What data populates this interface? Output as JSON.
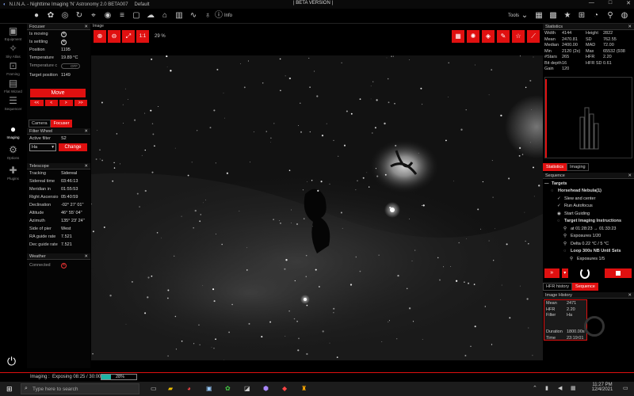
{
  "window": {
    "title": "N.I.N.A. - Nighttime Imaging 'N' Astronomy 2.0 BETA007",
    "profile": "Default",
    "beta_label": "| BETA VERSION |",
    "buttons": [
      "—",
      "□",
      "✕"
    ]
  },
  "toolbar": {
    "info_label": "Info",
    "tools_label": "Tools"
  },
  "sidebar": {
    "items": [
      {
        "label": "Equipment"
      },
      {
        "label": "Sky Atlas"
      },
      {
        "label": "Framing"
      },
      {
        "label": "Flat Wizard"
      },
      {
        "label": "Sequencer"
      },
      {
        "label": "Imaging"
      },
      {
        "label": "Options"
      },
      {
        "label": "Plugins"
      }
    ]
  },
  "focuser": {
    "title": "Focuser",
    "is_moving_label": "Is moving",
    "is_settling_label": "Is settling",
    "position_label": "Position",
    "position_value": "1195",
    "temperature_label": "Temperature",
    "temperature_value": "19.89 °C",
    "temp_comp_label": "Temperature c",
    "toggle_label": "OFF",
    "target_label": "Target position",
    "target_value": "1149",
    "move_label": "Move",
    "step_buttons": [
      "<<",
      "<",
      ">",
      ">>"
    ]
  },
  "left_tabs": [
    "Camera",
    "Focuser"
  ],
  "filter": {
    "title": "Filter Wheel",
    "active_label": "Active filter",
    "active_value": "S2",
    "select_value": "Ha",
    "change_label": "Change"
  },
  "telescope": {
    "title": "Telescope",
    "rows": [
      {
        "k": "Tracking",
        "v": "Sidereal"
      },
      {
        "k": "Sidereal time",
        "v": "03:46:13"
      },
      {
        "k": "Meridian in",
        "v": "01:55:53"
      },
      {
        "k": "Right Ascensio",
        "v": "05:40:59"
      },
      {
        "k": "Declination",
        "v": "-02° 27' 01\""
      },
      {
        "k": "Altitude",
        "v": "46° 55' 04\""
      },
      {
        "k": "Azimuth",
        "v": "135° 23' 24\""
      },
      {
        "k": "Side of pier",
        "v": "West"
      },
      {
        "k": "RA guide rate",
        "v": "7.521"
      },
      {
        "k": "Dec guide rate",
        "v": "7.521"
      }
    ]
  },
  "weather": {
    "title": "Weather",
    "connected_label": "Connected"
  },
  "image": {
    "title": "Image",
    "zoom_label": "1:1",
    "zoom_value": "29 %"
  },
  "statistics": {
    "title": "Statistics",
    "rows": [
      {
        "k1": "Width",
        "v1": "4144",
        "k2": "Height",
        "v2": "2822"
      },
      {
        "k1": "Mean",
        "v1": "2470.81",
        "k2": "SD",
        "v2": "762.55"
      },
      {
        "k1": "Median",
        "v1": "2400.00",
        "k2": "MAD",
        "v2": "72.00"
      },
      {
        "k1": "Min",
        "v1": "2120 (2x)",
        "k2": "Max",
        "v2": "65532 (938"
      },
      {
        "k1": "#Stars",
        "v1": "265",
        "k2": "HFR",
        "v2": "2.20"
      },
      {
        "k1": "Bit depth",
        "v1": "16",
        "k2": "HFR SD",
        "v2": "0.61"
      },
      {
        "k1": "Gain",
        "v1": "120",
        "k2": "",
        "v2": ""
      }
    ]
  },
  "right_tabs": [
    "Statistics",
    "Imaging"
  ],
  "sequence": {
    "title": "Sequence",
    "items": [
      {
        "text": "Targets",
        "indent": 0,
        "bold": true
      },
      {
        "text": "Horsehead Nebula(1)",
        "indent": 1,
        "bold": true
      },
      {
        "text": "Slew and center",
        "indent": 2,
        "bold": false
      },
      {
        "text": "Run Autofocus",
        "indent": 2,
        "bold": false
      },
      {
        "text": "Start Guiding",
        "indent": 2,
        "bold": false
      },
      {
        "text": "Target Imaging Instructions",
        "indent": 2,
        "bold": true
      },
      {
        "text": "at 01:28:23 → 01:33:23",
        "indent": 3,
        "bold": false
      },
      {
        "text": "Exposures 1/20",
        "indent": 3,
        "bold": false
      },
      {
        "text": "Delta 0.22 °C / 5 °C",
        "indent": 3,
        "bold": false
      },
      {
        "text": "Loop 300s NB Until Sets",
        "indent": 3,
        "bold": true
      },
      {
        "text": "Exposures 1/5",
        "indent": 4,
        "bold": false
      }
    ]
  },
  "bottom_tabs": [
    "HFR history",
    "Sequence"
  ],
  "history": {
    "title": "Image History",
    "rows": [
      {
        "k": "Mean",
        "v": "2471"
      },
      {
        "k": "HFR",
        "v": "2.20"
      },
      {
        "k": "Filter",
        "v": "Ha"
      }
    ],
    "rows2": [
      {
        "k": "Duration",
        "v": "1800.00s"
      },
      {
        "k": "Time",
        "v": "23:19:01"
      }
    ]
  },
  "status": {
    "label": "Imaging :",
    "text": "Exposing 08:25 / 30:00",
    "progress_percent": 28,
    "progress_label": "28%"
  },
  "taskbar": {
    "search_placeholder": "Type here to search",
    "time": "11:27 PM",
    "date": "12/4/2021"
  }
}
